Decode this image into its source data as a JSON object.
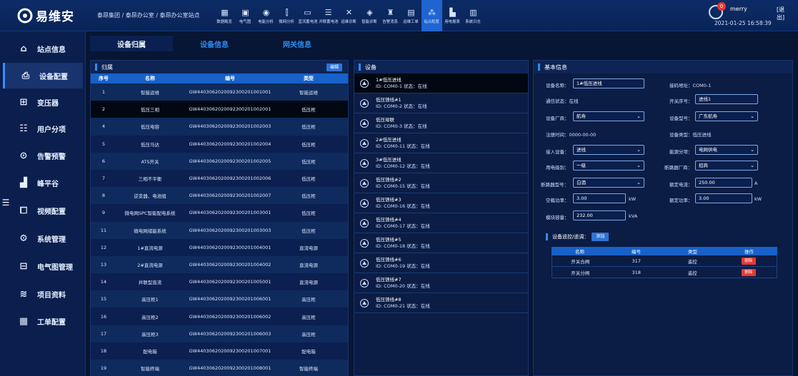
{
  "header": {
    "brand": "易维安",
    "breadcrumb": "泰昂集团 / 泰昂办公室 / 泰昂办公室站点",
    "nav": [
      {
        "label": "数据概览",
        "icon": "grid-icon",
        "glyph": "▦"
      },
      {
        "label": "电气图",
        "icon": "diagram-icon",
        "glyph": "▣"
      },
      {
        "label": "电能分析",
        "icon": "gauge-icon",
        "glyph": "◉"
      },
      {
        "label": "微网分析",
        "icon": "bar-icon",
        "glyph": "⫿"
      },
      {
        "label": "直流蓄电池",
        "icon": "battery-icon",
        "glyph": "▭"
      },
      {
        "label": "并联蓄电池",
        "icon": "stack-icon",
        "glyph": "☰"
      },
      {
        "label": "运维诊断",
        "icon": "tools-icon",
        "glyph": "✕"
      },
      {
        "label": "智能诊断",
        "icon": "shield-icon",
        "glyph": "◈"
      },
      {
        "label": "告警消息",
        "icon": "bell-icon",
        "glyph": "♜"
      },
      {
        "label": "运维工单",
        "icon": "clipboard-icon",
        "glyph": "▤"
      },
      {
        "label": "站点配置",
        "icon": "network-icon",
        "glyph": "⁂",
        "active": true
      },
      {
        "label": "用电报表",
        "icon": "chart-icon",
        "glyph": "▙"
      },
      {
        "label": "系统日志",
        "icon": "log-icon",
        "glyph": "▥"
      }
    ],
    "user": {
      "badge": "0",
      "name": "merry",
      "logout": "[退出]",
      "datetime": "2021-01-25 16:58:39"
    }
  },
  "sidebar": {
    "items": [
      {
        "label": "站点信息",
        "icon": "home-icon",
        "glyph": "⌂"
      },
      {
        "label": "设备配置",
        "icon": "device-icon",
        "glyph": "⎙",
        "active": true
      },
      {
        "label": "变压器",
        "icon": "transformer-icon",
        "glyph": "⊞"
      },
      {
        "label": "用户分项",
        "icon": "list-icon",
        "glyph": "☷"
      },
      {
        "label": "告警预警",
        "icon": "alert-icon",
        "glyph": "⊙"
      },
      {
        "label": "峰平谷",
        "icon": "signal-icon",
        "glyph": "▟"
      },
      {
        "label": "视频配置",
        "icon": "video-icon",
        "glyph": "⧠"
      },
      {
        "label": "系统管理",
        "icon": "settings-icon",
        "glyph": "⚙"
      },
      {
        "label": "电气图管理",
        "icon": "diagram-manage-icon",
        "glyph": "⊟"
      },
      {
        "label": "项目资料",
        "icon": "layers-icon",
        "glyph": "≋"
      },
      {
        "label": "工单配置",
        "icon": "calendar-icon",
        "glyph": "▦"
      }
    ]
  },
  "tabs": [
    {
      "label": "设备归属",
      "active": true
    },
    {
      "label": "设备信息"
    },
    {
      "label": "网关信息"
    }
  ],
  "ownership": {
    "title": "归属",
    "edit_label": "编辑",
    "columns": [
      "序号",
      "名称",
      "编号",
      "类型"
    ],
    "selected_index": 1,
    "rows": [
      [
        "1",
        "智能运维",
        "GW4403062020092300201001001",
        "智能运维"
      ],
      [
        "2",
        "低压三相",
        "GW4403062020092300201002001",
        "低压柜"
      ],
      [
        "4",
        "低压电容",
        "GW4403062020092300201002003",
        "低压柜"
      ],
      [
        "5",
        "低压马达",
        "GW4403062020092300201002004",
        "低压柜"
      ],
      [
        "6",
        "ATS开关",
        "GW4403062020092300201002005",
        "低压柜"
      ],
      [
        "7",
        "三相不平衡",
        "GW4403062020092300201002006",
        "低压柜"
      ],
      [
        "8",
        "逆变器、电池组",
        "GW4403062020092300201002007",
        "低压柜"
      ],
      [
        "9",
        "微电网SPC智能配电系统",
        "GW4403062020092300201003001",
        "低压柜"
      ],
      [
        "11",
        "微电网储能系统",
        "GW4403062020092300201003003",
        "低压柜"
      ],
      [
        "12",
        "1#直流电源",
        "GW4403062020092300201004001",
        "直流电源"
      ],
      [
        "13",
        "2#直流电源",
        "GW4403062020092300201004002",
        "直流电源"
      ],
      [
        "14",
        "并联型直流",
        "GW4403062020092300201005001",
        "直流电源"
      ],
      [
        "15",
        "高压柜1",
        "GW4403062020092300201006001",
        "高压柜"
      ],
      [
        "16",
        "高压柜2",
        "GW4403062020092300201006002",
        "高压柜"
      ],
      [
        "17",
        "高压柜3",
        "GW4403062020092300201006003",
        "高压柜"
      ],
      [
        "18",
        "配电箱",
        "GW4403062020092300201007001",
        "配电箱"
      ],
      [
        "19",
        "智能终端",
        "GW4403062020092300201008001",
        "智能终端"
      ]
    ]
  },
  "devices": {
    "title": "设备",
    "selected_index": 0,
    "items": [
      {
        "name": "1#低压进线",
        "sub": "ID: COM0-1 状态：在线"
      },
      {
        "name": "低压馈线#1",
        "sub": "ID: COM0-2 状态：在线"
      },
      {
        "name": "低压母联",
        "sub": "ID: COM0-3 状态：在线"
      },
      {
        "name": "2#低压进线",
        "sub": "ID: COM0-11 状态：在线"
      },
      {
        "name": "3#低压进线",
        "sub": "ID: COM0-12 状态：在线"
      },
      {
        "name": "低压馈线#2",
        "sub": "ID: COM0-15 状态：在线"
      },
      {
        "name": "低压馈线#3",
        "sub": "ID: COM0-16 状态：在线"
      },
      {
        "name": "低压馈线#4",
        "sub": "ID: COM0-17 状态：在线"
      },
      {
        "name": "低压馈线#5",
        "sub": "ID: COM0-18 状态：在线"
      },
      {
        "name": "低压馈线#6",
        "sub": "ID: COM0-19 状态：在线"
      },
      {
        "name": "低压馈线#7",
        "sub": "ID: COM0-20 状态：在线"
      },
      {
        "name": "低压馈线#8",
        "sub": "ID: COM0-21 状态：在线"
      }
    ]
  },
  "basic": {
    "title": "基本信息",
    "device_name_label": "设备名称：",
    "device_name": "1#低压进线",
    "addr_label": "接码地址：COM0-1",
    "comm_label": "通信状态：在线",
    "switch_no_label": "开关序号：",
    "switch_no": "进线1",
    "vendor_label": "设备厂商：",
    "vendor": "航寿",
    "model_label": "设备型号：",
    "model": "广东航寿",
    "reg_time_label": "注册时间：0000-00-00",
    "type_label": "设备类型：低压进线",
    "access_label": "接入设备：",
    "access": "进线",
    "energy_label": "能源分项：",
    "energy": "电网供电",
    "level_label": "用电级别：",
    "level": "一级",
    "breaker_vendor_label": "断路器厂商：",
    "breaker_vendor": "招商",
    "breaker_model_label": "断路器型号：",
    "breaker_model": "白酒",
    "rated_current_label": "额定电流：",
    "rated_current": "250.00",
    "rated_current_unit": "A",
    "noload_label": "空载功率：",
    "noload": "3.00",
    "noload_unit": "kW",
    "rated_power_label": "额定功率：",
    "rated_power": "3.00",
    "rated_power_unit": "kW",
    "capacity_label": "模块容量：",
    "capacity": "232.00",
    "capacity_unit": "kVA"
  },
  "control": {
    "title": "设备遥控/遥调：",
    "add_label": "添加",
    "columns": [
      "名称",
      "编号",
      "类型",
      "操作"
    ],
    "delete_label": "删除",
    "rows": [
      [
        "开关合闸",
        "317",
        "遥控"
      ],
      [
        "开关分闸",
        "318",
        "遥控"
      ]
    ]
  }
}
